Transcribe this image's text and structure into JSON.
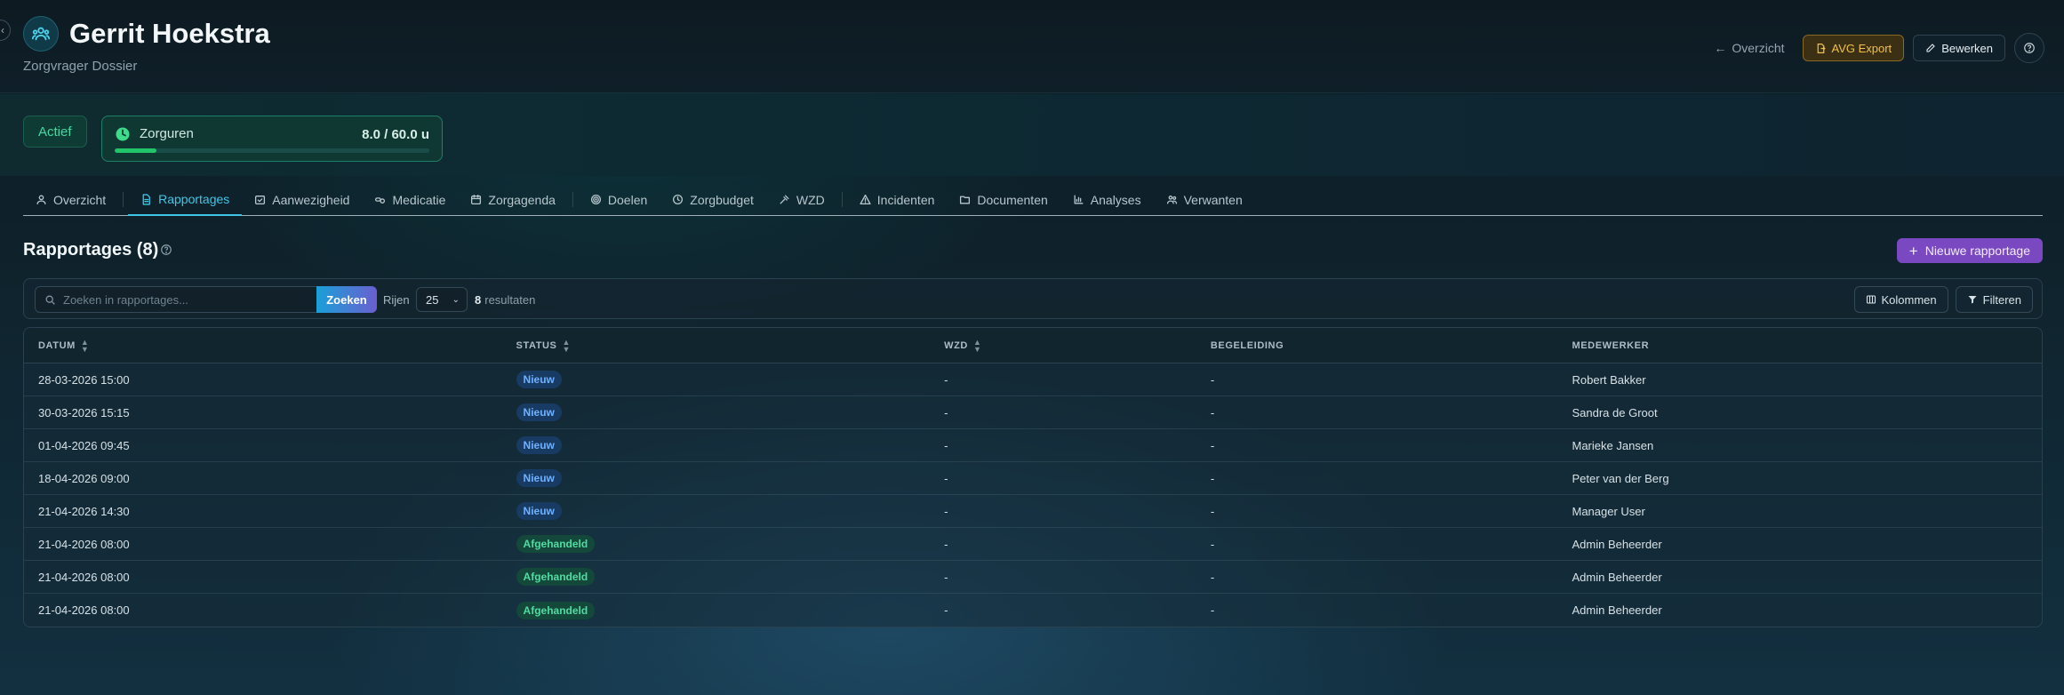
{
  "header": {
    "title": "Gerrit Hoekstra",
    "subtitle": "Zorgvrager Dossier",
    "overview_link": "Overzicht",
    "avg_export": "AVG Export",
    "edit": "Bewerken"
  },
  "status": {
    "badge": "Actief",
    "hours_label": "Zorguren",
    "hours_value": "8.0 / 60.0 u",
    "hours_fraction": 0.133
  },
  "tabs": [
    {
      "label": "Overzicht",
      "icon": "user-icon"
    },
    {
      "label": "Rapportages",
      "icon": "document-icon",
      "active": true
    },
    {
      "label": "Aanwezigheid",
      "icon": "calendar-check-icon"
    },
    {
      "label": "Medicatie",
      "icon": "pill-icon"
    },
    {
      "label": "Zorgagenda",
      "icon": "calendar-icon"
    },
    {
      "label": "Doelen",
      "icon": "target-icon"
    },
    {
      "label": "Zorgbudget",
      "icon": "clock-icon"
    },
    {
      "label": "WZD",
      "icon": "gavel-icon"
    },
    {
      "label": "Incidenten",
      "icon": "warning-icon"
    },
    {
      "label": "Documenten",
      "icon": "folder-icon"
    },
    {
      "label": "Analyses",
      "icon": "chart-icon"
    },
    {
      "label": "Verwanten",
      "icon": "users-icon"
    }
  ],
  "section": {
    "title": "Rapportages (8)",
    "new_button": "Nieuwe rapportage"
  },
  "toolbar": {
    "search_placeholder": "Zoeken in rapportages...",
    "search_button": "Zoeken",
    "rows_label": "Rijen",
    "rows_value": "25",
    "result_count": "8",
    "result_label": "resultaten",
    "columns_button": "Kolommen",
    "filter_button": "Filteren"
  },
  "table": {
    "headers": [
      "DATUM",
      "STATUS",
      "WZD",
      "BEGELEIDING",
      "MEDEWERKER"
    ],
    "rows": [
      {
        "datum": "28-03-2026 15:00",
        "status": "Nieuw",
        "wzd": "-",
        "begeleiding": "-",
        "medewerker": "Robert Bakker"
      },
      {
        "datum": "30-03-2026 15:15",
        "status": "Nieuw",
        "wzd": "-",
        "begeleiding": "-",
        "medewerker": "Sandra de Groot"
      },
      {
        "datum": "01-04-2026 09:45",
        "status": "Nieuw",
        "wzd": "-",
        "begeleiding": "-",
        "medewerker": "Marieke Jansen"
      },
      {
        "datum": "18-04-2026 09:00",
        "status": "Nieuw",
        "wzd": "-",
        "begeleiding": "-",
        "medewerker": "Peter van der Berg"
      },
      {
        "datum": "21-04-2026 14:30",
        "status": "Nieuw",
        "wzd": "-",
        "begeleiding": "-",
        "medewerker": "Manager User"
      },
      {
        "datum": "21-04-2026 08:00",
        "status": "Afgehandeld",
        "wzd": "-",
        "begeleiding": "-",
        "medewerker": "Admin Beheerder"
      },
      {
        "datum": "21-04-2026 08:00",
        "status": "Afgehandeld",
        "wzd": "-",
        "begeleiding": "-",
        "medewerker": "Admin Beheerder"
      },
      {
        "datum": "21-04-2026 08:00",
        "status": "Afgehandeld",
        "wzd": "-",
        "begeleiding": "-",
        "medewerker": "Admin Beheerder"
      }
    ]
  },
  "colors": {
    "accent": "#3fc6e6",
    "active_green": "#46d8a2",
    "new_badge": "#6fb1ff",
    "done_badge": "#4fdca2",
    "primary_purple": "#7a49c2",
    "avg_gold": "#f2c04a"
  }
}
